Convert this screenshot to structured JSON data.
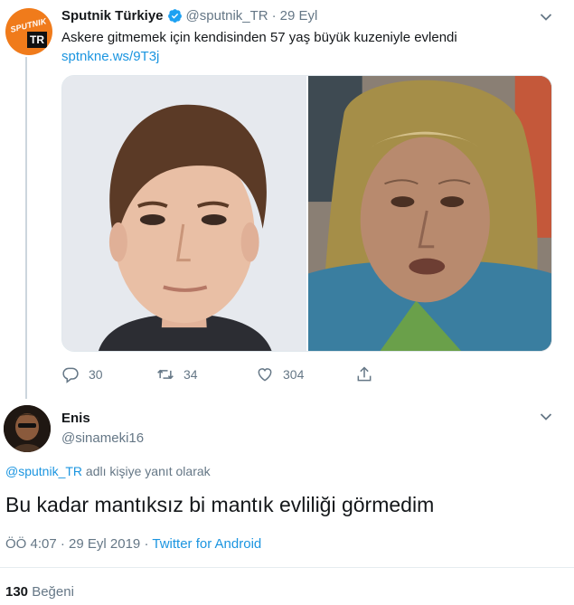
{
  "parent_tweet": {
    "display_name": "Sputnik Türkiye",
    "handle": "@sputnik_TR",
    "separator": "·",
    "date": "29 Eyl",
    "avatar": {
      "logo_word": "SPUTNIK",
      "logo_badge": "TR"
    },
    "text": "Askere gitmemek için kendisinden 57 yaş büyük kuzeniyle evlendi",
    "link": "sptnkne.ws/9T3j",
    "actions": {
      "replies": "30",
      "retweets": "34",
      "likes": "304"
    },
    "icons": [
      "verified-badge-icon",
      "chevron-down-icon",
      "reply-icon",
      "retweet-icon",
      "like-heart-icon",
      "share-icon"
    ]
  },
  "reply_tweet": {
    "display_name": "Enis",
    "handle": "@sinameki16",
    "replying_mention": "@sputnik_TR",
    "replying_suffix": "adlı kişiye yanıt olarak",
    "text": "Bu kadar mantıksız bi mantık evliliği görmedim",
    "time": "ÖÖ 4:07",
    "separator": "·",
    "date": "29 Eyl 2019",
    "source_sep": "·",
    "source": "Twitter for Android",
    "like_count": "130",
    "like_label": "Beğeni"
  },
  "colors": {
    "link_blue": "#1b95e0",
    "secondary_text": "#657786",
    "primary_text": "#14171a",
    "thread_line": "#ccd6dd",
    "sputnik_orange": "#f07b1b"
  }
}
